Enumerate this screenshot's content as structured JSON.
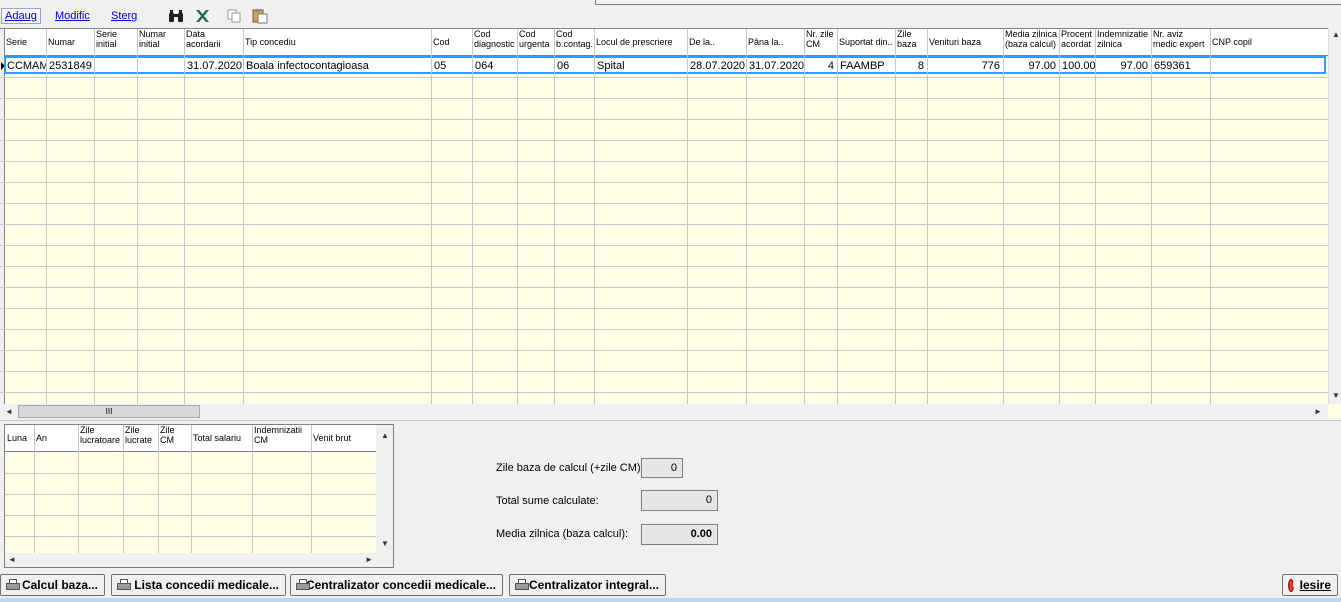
{
  "toolbar": {
    "add_label": "Adaug",
    "modify_label": "Modific",
    "delete_label": "Sterg",
    "icons": [
      "binoculars-icon",
      "excel-icon",
      "copy-icon",
      "paste-icon"
    ]
  },
  "main_grid": {
    "columns": [
      {
        "l1": "Serie",
        "l2": ""
      },
      {
        "l1": "Numar",
        "l2": ""
      },
      {
        "l1": "Serie",
        "l2": "initial"
      },
      {
        "l1": "Numar",
        "l2": "initial"
      },
      {
        "l1": "Data",
        "l2": "acordarii"
      },
      {
        "l1": "Tip concediu",
        "l2": ""
      },
      {
        "l1": "Cod",
        "l2": ""
      },
      {
        "l1": "Cod",
        "l2": "diagnostic"
      },
      {
        "l1": "Cod",
        "l2": "urgenta"
      },
      {
        "l1": "Cod",
        "l2": "b.contag."
      },
      {
        "l1": "Locul de prescriere",
        "l2": ""
      },
      {
        "l1": "De la..",
        "l2": ""
      },
      {
        "l1": "Pâna la..",
        "l2": ""
      },
      {
        "l1": "Nr. zile",
        "l2": "CM"
      },
      {
        "l1": "Suportat din..",
        "l2": ""
      },
      {
        "l1": "Zile",
        "l2": "baza"
      },
      {
        "l1": "Venituri baza",
        "l2": ""
      },
      {
        "l1": "Media zilnica",
        "l2": "(baza calcul)"
      },
      {
        "l1": "Procent",
        "l2": "acordat"
      },
      {
        "l1": "Indemnizatie",
        "l2": "zilnica"
      },
      {
        "l1": "Nr. aviz",
        "l2": "medic expert"
      },
      {
        "l1": "CNP copil",
        "l2": ""
      }
    ],
    "rows": [
      [
        "CCMAM",
        "2531849",
        "",
        "",
        "31.07.2020",
        "Boala infectocontagioasa",
        "05",
        "064",
        "",
        "06",
        "Spital",
        "28.07.2020",
        "31.07.2020",
        "4",
        "FAAMBP",
        "8",
        "776",
        "97.00",
        "100.00",
        "97.00",
        "659361",
        ""
      ]
    ],
    "hscroll_grip": "III"
  },
  "sub_grid": {
    "columns": [
      {
        "l1": "Luna",
        "l2": ""
      },
      {
        "l1": "An",
        "l2": ""
      },
      {
        "l1": "Zile",
        "l2": "lucratoare"
      },
      {
        "l1": "Zile",
        "l2": "lucrate"
      },
      {
        "l1": "Zile",
        "l2": "CM"
      },
      {
        "l1": "Total salariu",
        "l2": ""
      },
      {
        "l1": "Indemnizatii",
        "l2": "CM"
      },
      {
        "l1": "Venit brut",
        "l2": ""
      }
    ]
  },
  "summary": {
    "zile_label": "Zile baza de calcul (+zile CM):",
    "zile_value": "0",
    "total_label": "Total sume calculate:",
    "total_value": "0",
    "media_label": "Media zilnica (baza calcul):",
    "media_value": "0.00"
  },
  "buttons": {
    "calcul": "Calcul baza...",
    "lista": "Lista concedii medicale...",
    "centralizator": "Centralizator concedii medicale...",
    "integral": "Centralizator integral...",
    "iesire": "Iesire"
  }
}
